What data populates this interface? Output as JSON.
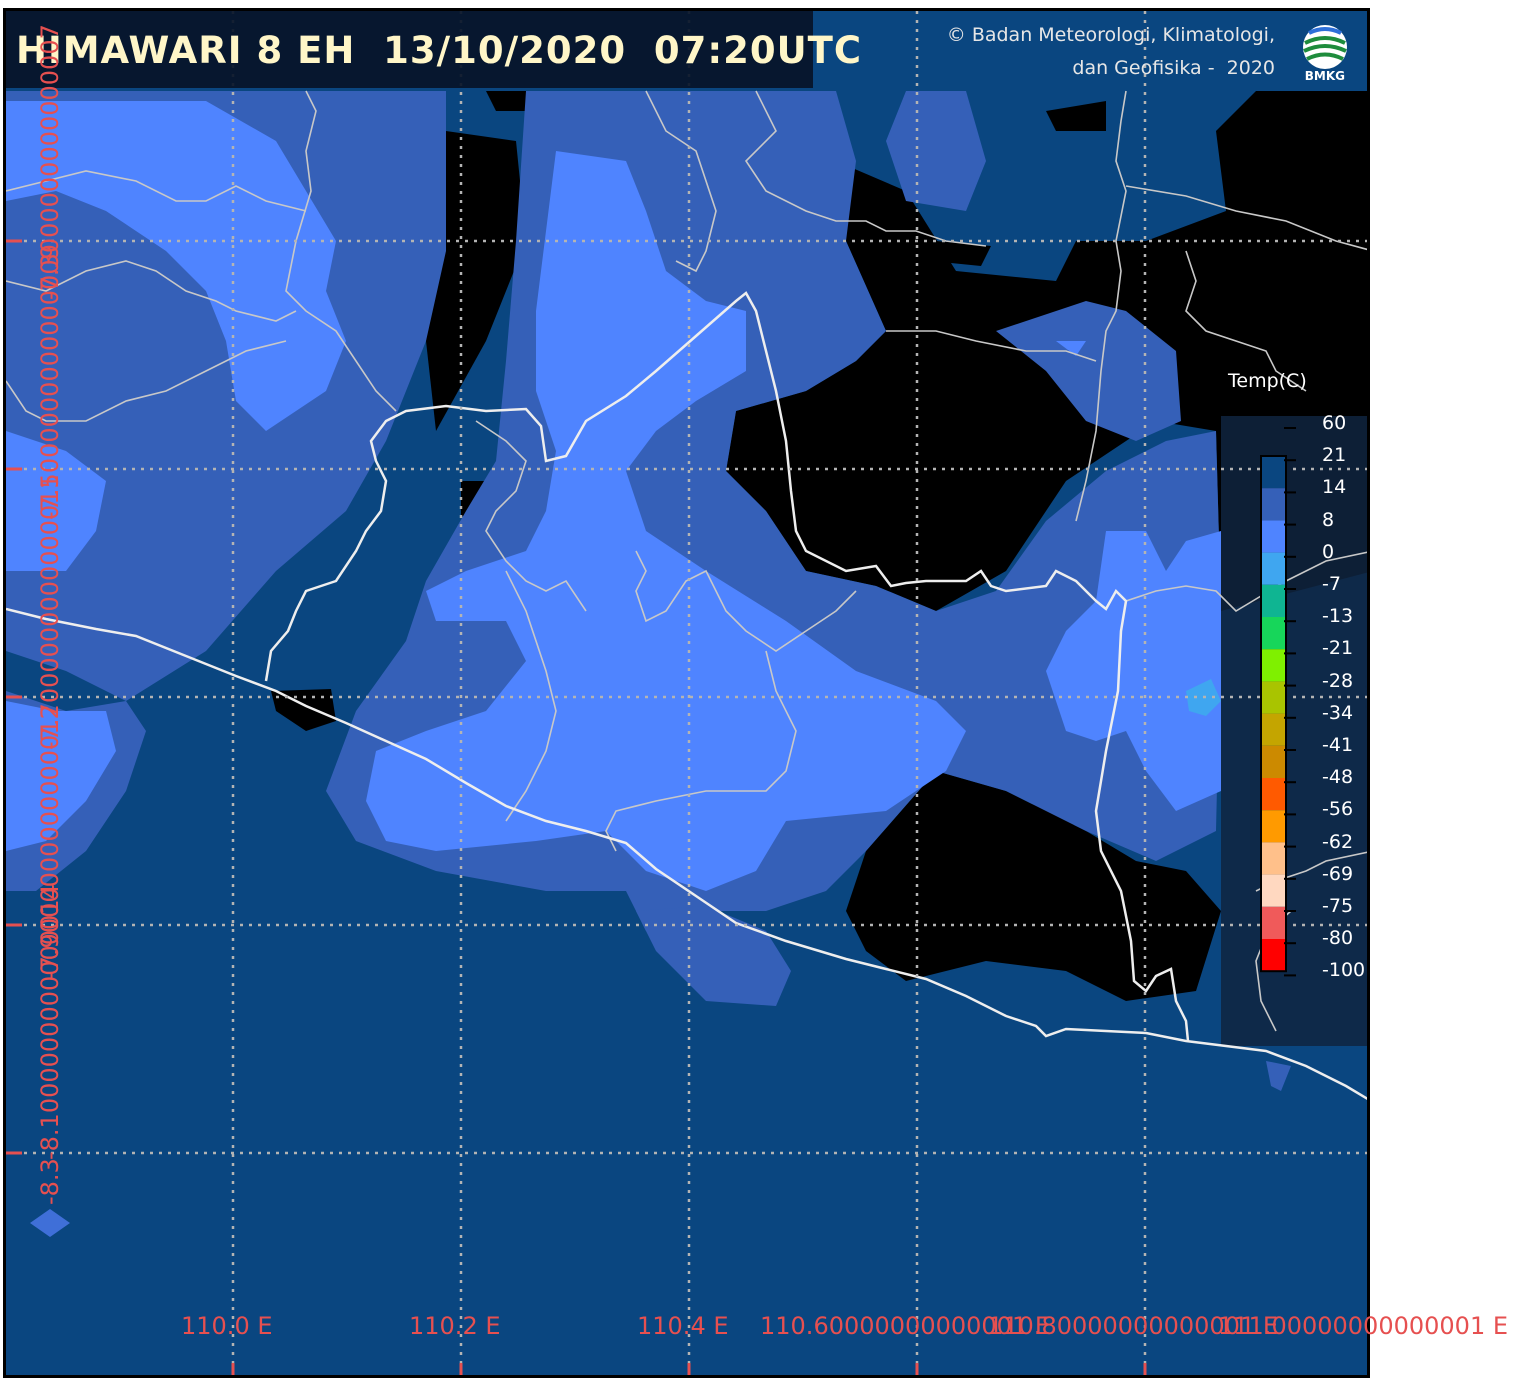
{
  "header": {
    "title": "HIMAWARI 8 EH  13/10/2020  07:20UTC",
    "credit_line1": "© Badan Meteorologi, Klimatologi,",
    "credit_line2": "dan Geofisika -  2020",
    "logo_text": "BMKG"
  },
  "legend": {
    "title": "Temp(C)",
    "labels": [
      "60",
      "21",
      "14",
      "8",
      "0",
      "-7",
      "-13",
      "-21",
      "-28",
      "-34",
      "-41",
      "-48",
      "-56",
      "-62",
      "-69",
      "-75",
      "-80",
      "-100"
    ],
    "colors": [
      "#0a4680",
      "#3560b8",
      "#4f84ff",
      "#3fa6f0",
      "#0fb592",
      "#17d65a",
      "#7ff000",
      "#a9c400",
      "#c4a500",
      "#cc8a00",
      "#ff5a00",
      "#ff9a00",
      "#ffc08a",
      "#ffd8c0",
      "#f05a5a",
      "#ff0000"
    ]
  },
  "axes": {
    "lon_labels": [
      "110.0 E",
      "110.2 E",
      "110.4 E",
      "110.60000000000001 E",
      "110.80000000000001 E",
      "111.00000000000001 E"
    ],
    "lat_labels": [
      "-7.3000000000000007",
      "-7.5000000000000009",
      "-7.7000000000000011",
      "-7.9000000000000012",
      "-8.1000000000000014",
      "-8.3"
    ]
  },
  "colors": {
    "background": "#0a4680",
    "cloud_mid": "#3560b8",
    "cloud_cold": "#4f84ff",
    "clear_land": "#000000",
    "grid": "#b4b4b4",
    "axis_label": "#e65050"
  }
}
